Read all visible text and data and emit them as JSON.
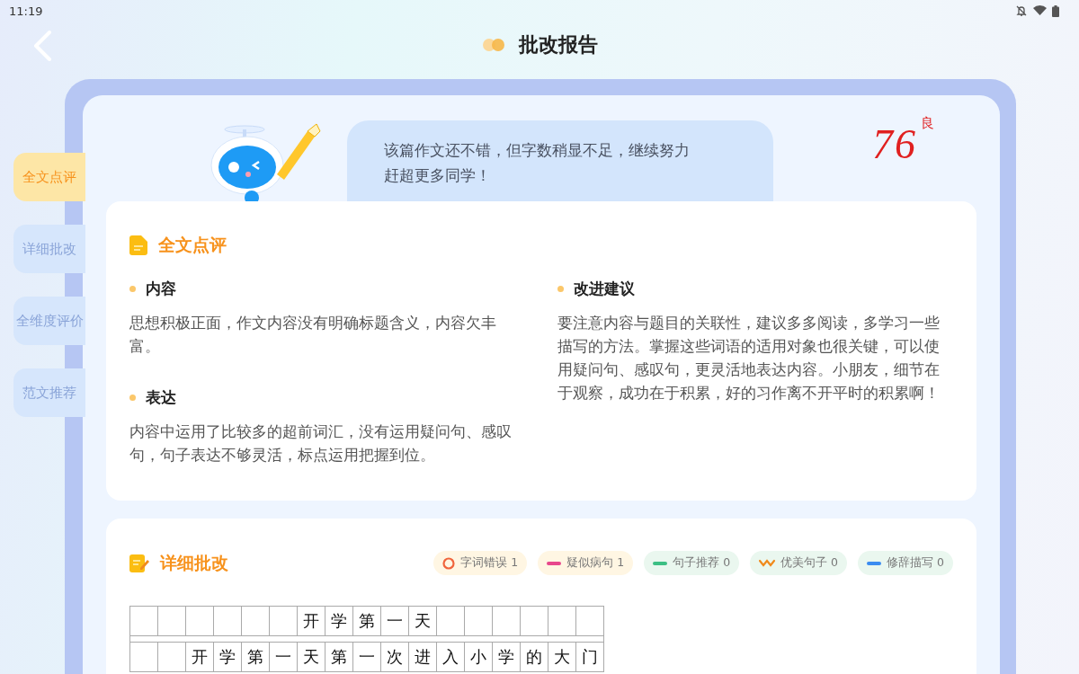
{
  "status_bar": {
    "time": "11:19"
  },
  "header": {
    "title": "批改报告"
  },
  "side_tabs": [
    {
      "label": "全文点评",
      "selected": true
    },
    {
      "label": "详细批改",
      "selected": false
    },
    {
      "label": "全维度评价",
      "selected": false
    },
    {
      "label": "范文推荐",
      "selected": false
    }
  ],
  "summary": {
    "comment_lines": [
      "该篇作文还不错，但字数稍显不足，继续努力",
      "赶超更多同学！"
    ],
    "score": "76",
    "grade": "良"
  },
  "overview": {
    "title": "全文点评",
    "left": [
      {
        "heading": "内容",
        "text": "思想积极正面，作文内容没有明确标题含义，内容欠丰富。"
      },
      {
        "heading": "表达",
        "text": "内容中运用了比较多的超前词汇，没有运用疑问句、感叹句，句子表达不够灵活，标点运用把握到位。"
      }
    ],
    "right": [
      {
        "heading": "改进建议",
        "text": "要注意内容与题目的关联性，建议多多阅读，多学习一些描写的方法。掌握这些词语的适用对象也很关键，可以使用疑问句、感叹句，更灵活地表达内容。小朋友，细节在于观察，成功在于积累，好的习作离不开平时的积累啊！"
      }
    ]
  },
  "detail": {
    "title": "详细批改",
    "legend": [
      {
        "label": "字词错误 1",
        "kind": "circle",
        "color": "#f0643c"
      },
      {
        "label": "疑似病句 1",
        "kind": "dash",
        "color": "#e8478c"
      },
      {
        "label": "句子推荐 0",
        "kind": "dash",
        "color": "#3cbf84"
      },
      {
        "label": "优美句子 0",
        "kind": "wave",
        "color": "#f08a1c"
      },
      {
        "label": "修辞描写 0",
        "kind": "dash",
        "color": "#3b8cf0"
      }
    ],
    "grid_rows": [
      "      开学第一天      ",
      "  开学第一天第一次进入小学的大门"
    ]
  }
}
